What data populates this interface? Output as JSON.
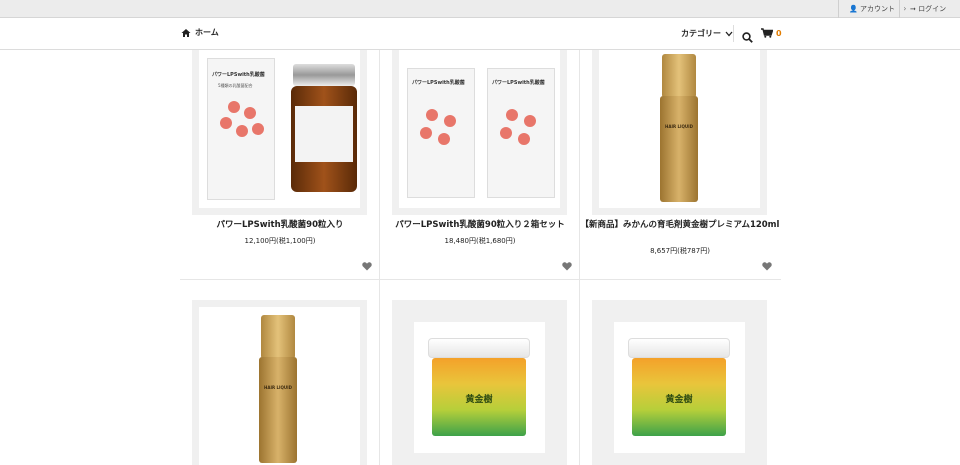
{
  "topbar": {
    "account_label": "アカウント",
    "login_label": "ログイン"
  },
  "nav": {
    "home_label": "ホーム",
    "category_label": "カテゴリー",
    "cart_count": "0"
  },
  "products": [
    {
      "name": "パワーLPSwith乳酸菌90粒入り",
      "price": "12,100円(税1,100円)"
    },
    {
      "name": "パワーLPSwith乳酸菌90粒入り２箱セット",
      "price": "18,480円(税1,680円)"
    },
    {
      "name": "【新商品】みかんの育毛剤黄金樹プレミアム120ml",
      "price": "8,657円(税787円)"
    }
  ],
  "product_art": {
    "box_title": "パワーLPSwith乳酸菌",
    "box_subtitle": "5種類の乳酸菌配合",
    "bottle_label": "HAIR LIQUID",
    "jar_label": "黄金樹"
  },
  "colors": {
    "accent": "#e27c00",
    "heart": "#777777"
  }
}
